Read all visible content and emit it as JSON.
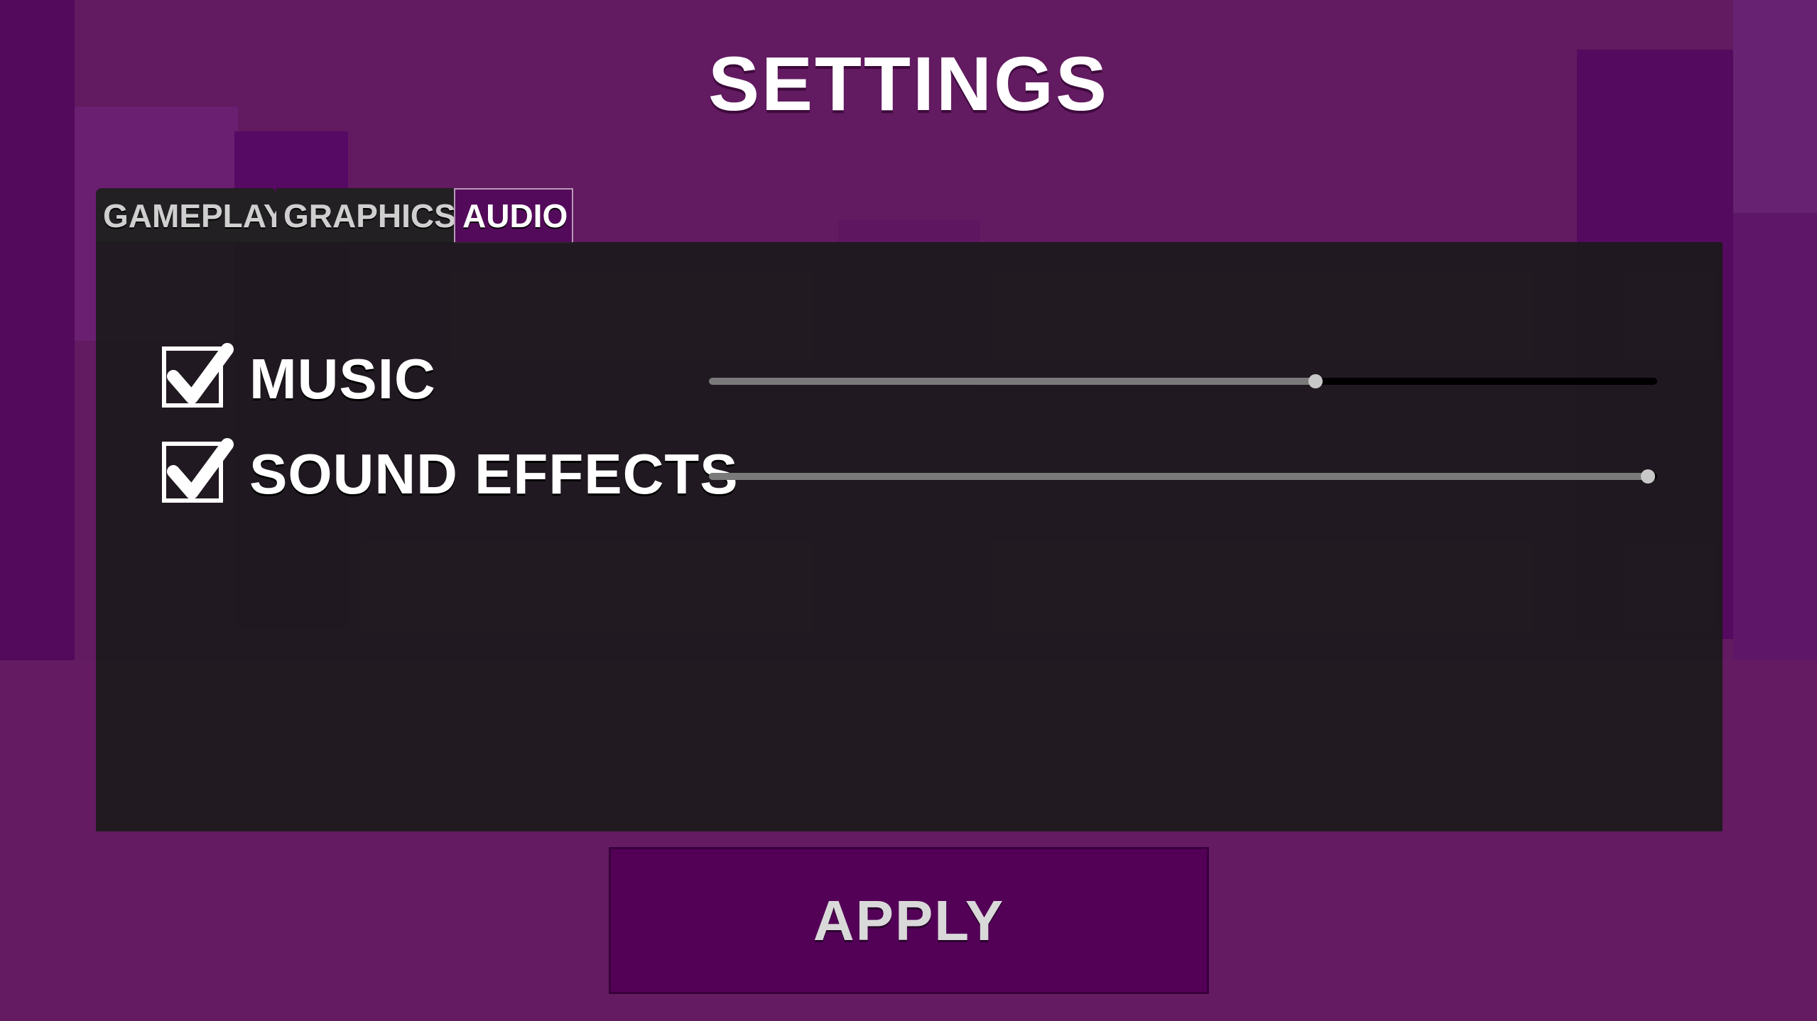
{
  "screen": {
    "title": "SETTINGS"
  },
  "tabs": [
    {
      "label": "GAMEPLAY",
      "active": false
    },
    {
      "label": "GRAPHICS",
      "active": false
    },
    {
      "label": "AUDIO",
      "active": true
    }
  ],
  "audio": {
    "music": {
      "label": "MUSIC",
      "enabled": true,
      "volume": 0.64
    },
    "sound_effects": {
      "label": "SOUND EFFECTS",
      "enabled": true,
      "volume": 0.99
    }
  },
  "apply_button": {
    "label": "APPLY"
  },
  "colors": {
    "background": "#621a60",
    "panel": "#1c1a1c",
    "accent": "#530057",
    "slider_fill": "#7a7a7a",
    "slider_track": "#000000"
  },
  "icons": {
    "check": "check-icon"
  }
}
